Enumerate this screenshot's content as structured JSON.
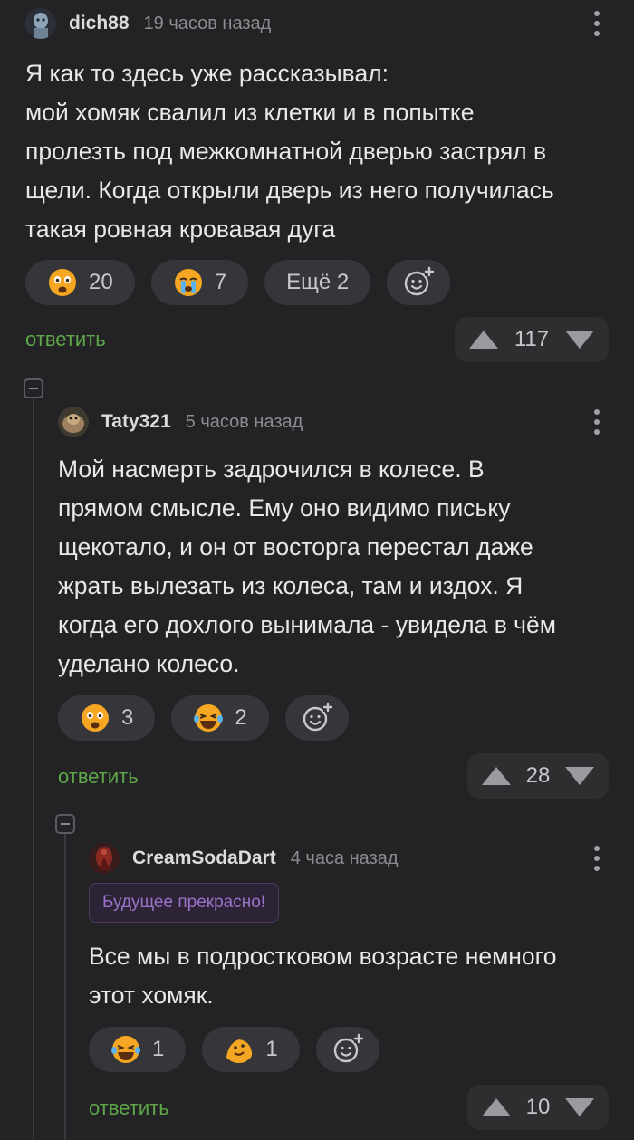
{
  "comments": [
    {
      "author": "dich88",
      "time": "19 часов назад",
      "text_lines": [
        "Я как то здесь уже рассказывал:",
        "мой хомяк свалил из клетки и в попытке",
        "пролезть под межкомнатной дверью застрял в",
        "щели. Когда открыли дверь из него получилась",
        "такая ровная кровавая дуга"
      ],
      "reactions": [
        {
          "icon": "shocked-face-emoji",
          "count": "20"
        },
        {
          "icon": "crying-face-emoji",
          "count": "7"
        },
        {
          "label": "Ещё 2"
        }
      ],
      "reply_label": "ответить",
      "rating": "117"
    },
    {
      "author": "Taty321",
      "time": "5 часов назад",
      "text_lines": [
        "Мой насмерть задрочился в колесе. В",
        "прямом смысле. Ему оно видимо письку",
        "щекотало, и он от восторга перестал даже",
        "жрать вылезать из колеса, там и издох. Я",
        "когда его дохлого вынимала - увидела в чём",
        "уделано колесо."
      ],
      "reactions": [
        {
          "icon": "shocked-face-emoji",
          "count": "3"
        },
        {
          "icon": "laughing-tears-emoji",
          "count": "2"
        }
      ],
      "reply_label": "ответить",
      "rating": "28"
    },
    {
      "author": "CreamSodaDart",
      "time": "4 часа назад",
      "badge": "Будущее прекрасно!",
      "text_lines": [
        "Все мы в подростковом возрасте немного",
        "этот хомяк."
      ],
      "reactions": [
        {
          "icon": "laughing-tears-emoji",
          "count": "1"
        },
        {
          "icon": "melting-face-emoji",
          "count": "1"
        }
      ],
      "reply_label": "ответить",
      "rating": "10"
    }
  ],
  "colors": {
    "background": "#232325",
    "reply_link": "#5fa84a",
    "badge_text": "#9a73c9",
    "emoji_fill": "#f5a623"
  }
}
